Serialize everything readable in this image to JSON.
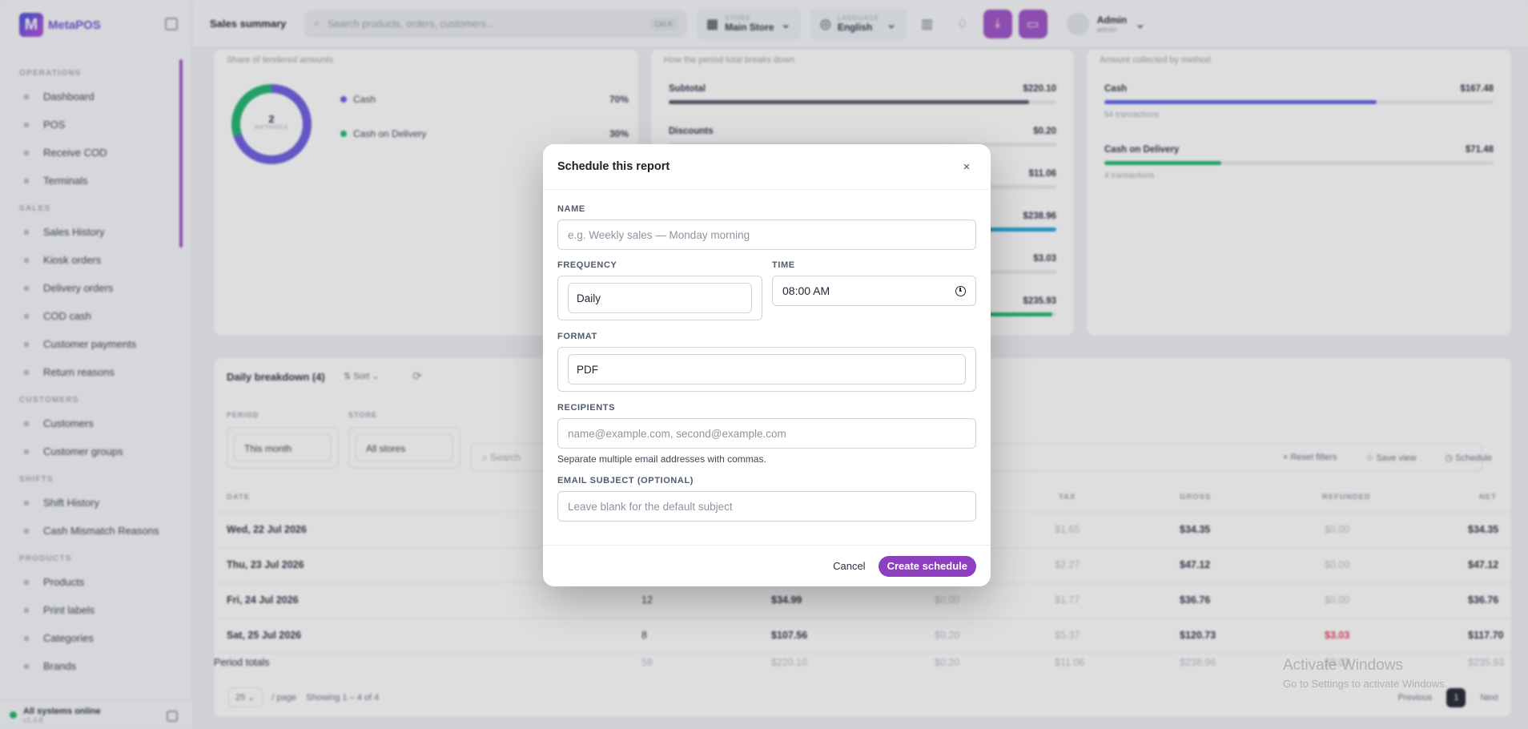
{
  "app": {
    "logo_text": "MetaPOS",
    "page_title": "Sales summary",
    "search_placeholder": "Search products, orders, customers...",
    "search_kbd": "Ctrl K",
    "store_caption": "STORE",
    "store_value": "Main Store",
    "lang_caption": "LANGUAGE",
    "lang_value": "English",
    "user_name": "Admin",
    "user_role": "admin",
    "status_text": "All systems online",
    "status_version": "v1.4.8"
  },
  "sidebar": {
    "sections": [
      {
        "title": "OPERATIONS",
        "items": [
          "Dashboard",
          "POS",
          "Receive COD",
          "Terminals"
        ]
      },
      {
        "title": "SALES",
        "items": [
          "Sales History",
          "Kiosk orders",
          "Delivery orders",
          "COD cash",
          "Customer payments",
          "Return reasons"
        ]
      },
      {
        "title": "CUSTOMERS",
        "items": [
          "Customers",
          "Customer groups"
        ]
      },
      {
        "title": "SHIFTS",
        "items": [
          "Shift History",
          "Cash Mismatch Reasons"
        ]
      },
      {
        "title": "PRODUCTS",
        "items": [
          "Products",
          "Print labels",
          "Categories",
          "Brands"
        ]
      }
    ]
  },
  "cards": {
    "tender_sub": "Share of tendered amounts",
    "donut_count": "2",
    "donut_caption": "METHODS",
    "tender_legend": [
      {
        "label": "Cash",
        "pct": "70%",
        "color": "#6a5ae0"
      },
      {
        "label": "Cash on Delivery",
        "pct": "30%",
        "color": "#1bb46b"
      }
    ],
    "breakdown_sub": "How the period total breaks down",
    "breakdown_rows": [
      {
        "label": "Subtotal",
        "value": "$220.10",
        "fill": 0.93,
        "color": "#4b5563"
      },
      {
        "label": "Discounts",
        "value": "$0.20",
        "fill": 0.0,
        "color": "#4b5563"
      },
      {
        "label": "",
        "value": "$11.06",
        "fill": 0.05,
        "color": "#4b5563"
      },
      {
        "label": "",
        "value": "$238.96",
        "fill": 1.0,
        "color": "#1aa3d8"
      },
      {
        "label": "",
        "value": "$3.03",
        "fill": 0.02,
        "color": "#4b5563"
      },
      {
        "label": "",
        "value": "$235.93",
        "fill": 0.99,
        "color": "#1bb46b"
      }
    ],
    "method_sub": "Amount collected by method",
    "method_rows": [
      {
        "label": "Cash",
        "value": "$167.48",
        "fill": 0.7,
        "note": "54 transactions",
        "color": "#5b5ce6"
      },
      {
        "label": "Cash on Delivery",
        "value": "$71.48",
        "fill": 0.3,
        "note": "4 transactions",
        "color": "#1bb46b"
      }
    ]
  },
  "panel": {
    "title": "Daily breakdown (4)",
    "sort_label": "Sort",
    "period_caption": "PERIOD",
    "period_value": "This month",
    "store_caption": "STORE",
    "store_value": "All stores",
    "search_placeholder": "Search",
    "reset_label": "Reset filters",
    "save_view_label": "Save view",
    "schedule_label": "Schedule",
    "headers": {
      "date": "DATE",
      "tax": "TAX",
      "gross": "GROSS",
      "refunded": "REFUNDED",
      "net": "NET"
    },
    "rows": [
      {
        "date": "Wed, 22 Jul 2026",
        "qty": "",
        "sub": "",
        "disc": "",
        "tax": "$1.65",
        "gross": "$34.35",
        "refunded": "$0.00",
        "net": "$34.35"
      },
      {
        "date": "Thu, 23 Jul 2026",
        "qty": "",
        "sub": "",
        "disc": "",
        "tax": "$2.27",
        "gross": "$47.12",
        "refunded": "$0.00",
        "net": "$47.12"
      },
      {
        "date": "Fri, 24 Jul 2026",
        "qty": "12",
        "sub": "$34.99",
        "disc": "$0.00",
        "tax": "$1.77",
        "gross": "$36.76",
        "refunded": "$0.00",
        "net": "$36.76"
      },
      {
        "date": "Sat, 25 Jul 2026",
        "qty": "8",
        "sub": "$107.56",
        "disc": "$0.20",
        "tax": "$5.37",
        "gross": "$120.73",
        "refunded": "$3.03",
        "net": "$117.70"
      }
    ],
    "totals": {
      "label": "Period totals",
      "qty": "58",
      "sub": "$220.10",
      "disc": "$0.20",
      "tax": "$11.06",
      "gross": "$238.96",
      "refunded": "$3.03",
      "net": "$235.93"
    },
    "page_size": "25",
    "per_page": "/ page",
    "showing": "Showing 1 – 4 of 4",
    "prev": "Previous",
    "current_page": "1",
    "next": "Next"
  },
  "watermark": {
    "line1": "Activate Windows",
    "line2": "Go to Settings to activate Windows."
  },
  "modal": {
    "title": "Schedule this report",
    "close": "×",
    "name_label": "NAME",
    "name_placeholder": "e.g. Weekly sales — Monday morning",
    "frequency_label": "FREQUENCY",
    "frequency_value": "Daily",
    "time_label": "TIME",
    "time_value": "08:00 AM",
    "format_label": "FORMAT",
    "format_value": "PDF",
    "recipients_label": "RECIPIENTS",
    "recipients_placeholder": "name@example.com, second@example.com",
    "recipients_hint": "Separate multiple email addresses with commas.",
    "subject_label": "EMAIL SUBJECT (OPTIONAL)",
    "subject_placeholder": "Leave blank for the default subject",
    "cancel": "Cancel",
    "create": "Create schedule"
  }
}
